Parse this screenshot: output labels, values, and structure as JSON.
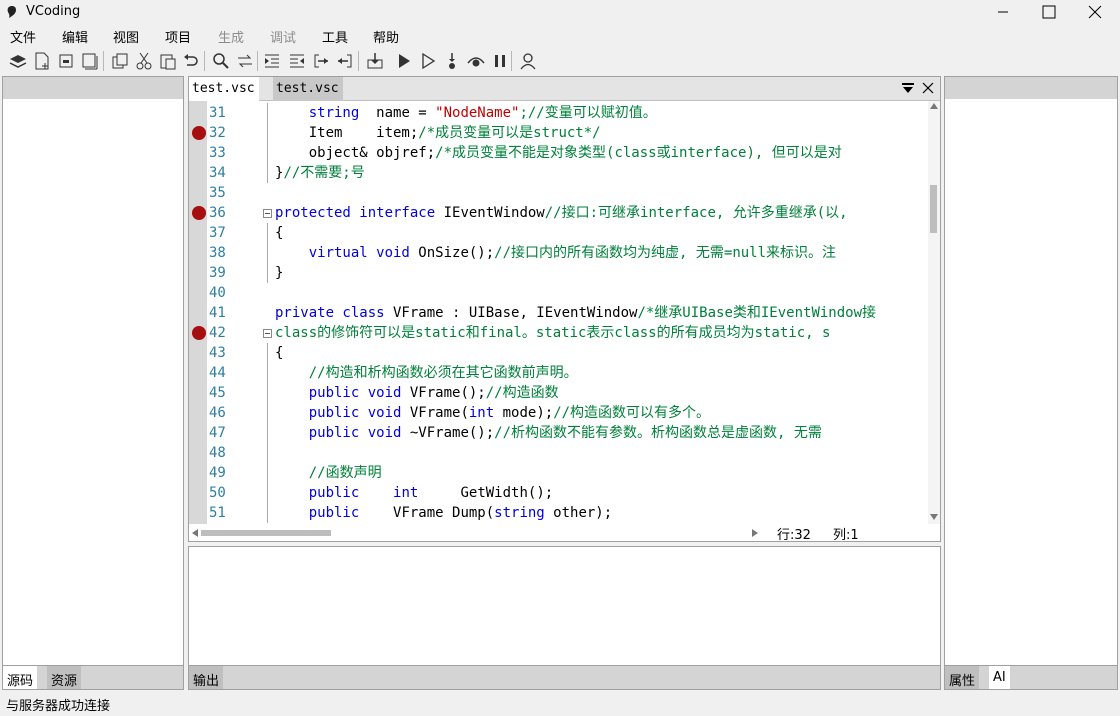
{
  "window": {
    "title": "VCoding"
  },
  "menu": [
    "文件",
    "编辑",
    "视图",
    "项目",
    "生成",
    "调试",
    "工具",
    "帮助"
  ],
  "menu_disabled": [
    false,
    false,
    false,
    false,
    true,
    true,
    false,
    false
  ],
  "toolbar_icons": [
    "layers-icon",
    "new-file-icon",
    "save-icon",
    "save-all-icon",
    "copy-icon",
    "cut-icon",
    "paste-icon",
    "undo-icon",
    "find-icon",
    "replace-icon",
    "indent-icon",
    "outdent-icon",
    "step-in-icon",
    "step-out-icon",
    "build-icon",
    "run-icon",
    "run-outline-icon",
    "step-icon",
    "watch-icon",
    "pause-icon",
    "user-icon"
  ],
  "left_panel": {
    "tabs": [
      "源码",
      "资源"
    ]
  },
  "right_panel": {
    "tabs": [
      "属性",
      "AI"
    ]
  },
  "output_panel": {
    "tab": "输出"
  },
  "editor": {
    "tabs": [
      "test.vsc",
      "test.vsc"
    ],
    "position": {
      "line_label": "行:32",
      "col_label": "列:1"
    },
    "lines": [
      {
        "n": "31",
        "bp": false,
        "fold": false,
        "guide": true,
        "segs": [
          [
            "    ",
            ""
          ],
          [
            "string",
            "kw"
          ],
          [
            "  name = ",
            ""
          ],
          [
            "\"NodeName\"",
            "st"
          ],
          [
            ";//变量可以赋初值。",
            "cm"
          ]
        ]
      },
      {
        "n": "32",
        "bp": true,
        "fold": false,
        "guide": true,
        "segs": [
          [
            "    Item    item;",
            ""
          ],
          [
            "/*成员变量可以是struct*/",
            "cm"
          ]
        ]
      },
      {
        "n": "33",
        "bp": false,
        "fold": false,
        "guide": true,
        "segs": [
          [
            "    object& objref;",
            ""
          ],
          [
            "/*成员变量不能是对象类型(class或interface), 但可以是对",
            "cm"
          ]
        ]
      },
      {
        "n": "34",
        "bp": false,
        "fold": false,
        "guide": true,
        "segs": [
          [
            "}",
            ""
          ],
          [
            "//不需要;号",
            "cm"
          ]
        ]
      },
      {
        "n": "35",
        "bp": false,
        "fold": false,
        "guide": false,
        "segs": []
      },
      {
        "n": "36",
        "bp": true,
        "fold": true,
        "guide": false,
        "segs": [
          [
            "protected interface",
            "kw"
          ],
          [
            " IEventWindow",
            ""
          ],
          [
            "//接口:可继承interface, 允许多重继承(以,",
            "cm"
          ]
        ]
      },
      {
        "n": "37",
        "bp": false,
        "fold": false,
        "guide": true,
        "segs": [
          [
            "{",
            ""
          ]
        ]
      },
      {
        "n": "38",
        "bp": false,
        "fold": false,
        "guide": true,
        "segs": [
          [
            "    ",
            ""
          ],
          [
            "virtual void",
            "kw"
          ],
          [
            " OnSize();",
            ""
          ],
          [
            "//接口内的所有函数均为纯虚, 无需=null来标识。注",
            "cm"
          ]
        ]
      },
      {
        "n": "39",
        "bp": false,
        "fold": false,
        "guide": true,
        "segs": [
          [
            "}",
            ""
          ]
        ]
      },
      {
        "n": "40",
        "bp": false,
        "fold": false,
        "guide": false,
        "segs": []
      },
      {
        "n": "41",
        "bp": false,
        "fold": false,
        "guide": false,
        "segs": [
          [
            "private class",
            "kw"
          ],
          [
            " VFrame : UIBase, IEventWindow",
            ""
          ],
          [
            "/*继承UIBase类和IEventWindow接",
            "cm"
          ]
        ]
      },
      {
        "n": "42",
        "bp": true,
        "fold": true,
        "guide": false,
        "segs": [
          [
            "class的修饰符可以是static和final。static表示class的所有成员均为static, s",
            "cm"
          ]
        ]
      },
      {
        "n": "43",
        "bp": false,
        "fold": false,
        "guide": true,
        "segs": [
          [
            "{",
            ""
          ]
        ]
      },
      {
        "n": "44",
        "bp": false,
        "fold": false,
        "guide": true,
        "segs": [
          [
            "    ",
            ""
          ],
          [
            "//构造和析构函数必须在其它函数前声明。",
            "cm"
          ]
        ]
      },
      {
        "n": "45",
        "bp": false,
        "fold": false,
        "guide": true,
        "segs": [
          [
            "    ",
            ""
          ],
          [
            "public void",
            "kw"
          ],
          [
            " VFrame();",
            ""
          ],
          [
            "//构造函数",
            "cm"
          ]
        ]
      },
      {
        "n": "46",
        "bp": false,
        "fold": false,
        "guide": true,
        "segs": [
          [
            "    ",
            ""
          ],
          [
            "public void",
            "kw"
          ],
          [
            " VFrame(",
            ""
          ],
          [
            "int",
            "kw"
          ],
          [
            " mode);",
            ""
          ],
          [
            "//构造函数可以有多个。",
            "cm"
          ]
        ]
      },
      {
        "n": "47",
        "bp": false,
        "fold": false,
        "guide": true,
        "segs": [
          [
            "    ",
            ""
          ],
          [
            "public void",
            "kw"
          ],
          [
            " ~VFrame();",
            ""
          ],
          [
            "//析构函数不能有参数。析构函数总是虚函数, 无需",
            "cm"
          ]
        ]
      },
      {
        "n": "48",
        "bp": false,
        "fold": false,
        "guide": true,
        "segs": []
      },
      {
        "n": "49",
        "bp": false,
        "fold": false,
        "guide": true,
        "segs": [
          [
            "    ",
            ""
          ],
          [
            "//函数声明",
            "cm"
          ]
        ]
      },
      {
        "n": "50",
        "bp": false,
        "fold": false,
        "guide": true,
        "segs": [
          [
            "    ",
            ""
          ],
          [
            "public",
            "kw"
          ],
          [
            "    ",
            ""
          ],
          [
            "int",
            "kw"
          ],
          [
            "     GetWidth();",
            ""
          ]
        ]
      },
      {
        "n": "51",
        "bp": false,
        "fold": false,
        "guide": true,
        "segs": [
          [
            "    ",
            ""
          ],
          [
            "public",
            "kw"
          ],
          [
            "    VFrame Dump(",
            ""
          ],
          [
            "string",
            "kw"
          ],
          [
            " other);",
            ""
          ]
        ]
      }
    ]
  },
  "status": {
    "text": "与服务器成功连接"
  }
}
